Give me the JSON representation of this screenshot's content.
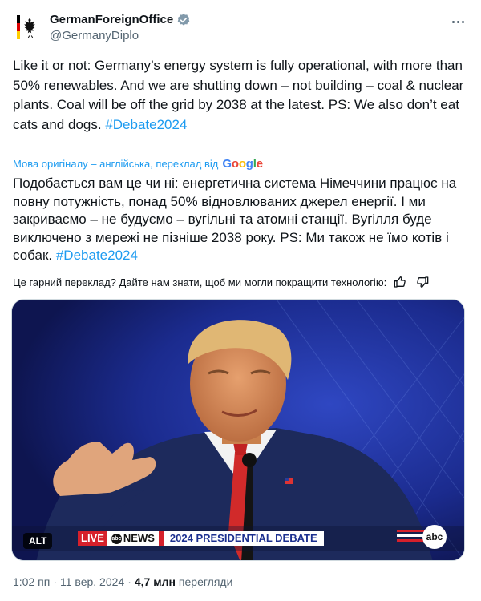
{
  "author": {
    "display_name": "GermanForeignOffice",
    "handle": "@GermanyDiplo",
    "verified_icon": "gov-verified-badge-icon",
    "avatar_icon": "federal-eagle-icon"
  },
  "tweet": {
    "text_before_hashtag": "Like it or not: Germany’s energy system is fully operational, with more than 50% renewables. And we are shutting down – not building – coal & nuclear plants. Coal will be off the grid by 2038 at the latest. PS: We also don’t eat cats and dogs. ",
    "hashtag": "#Debate2024"
  },
  "translation": {
    "note": "Мова оригіналу – англійська, переклад від",
    "provider": "Google",
    "text_before_hashtag": "Подобається вам це чи ні: енергетична система Німеччини працює на повну потужність, понад 50% відновлюваних джерел енергії. І ми закриваємо – не будуємо – вугільні та атомні станції. Вугілля буде виключено з мережі не пізніше 2038 року. PS: Ми також не їмо котів і собак. ",
    "hashtag": "#Debate2024",
    "feedback_prompt": "Це гарний переклад? Дайте нам знати, щоб ми могли покращити технологію:"
  },
  "media": {
    "alt_badge": "ALT",
    "live_label": "LIVE",
    "network_label": "NEWS",
    "network_circle": "abc",
    "banner_label": "2024 PRESIDENTIAL DEBATE",
    "corner_logo": "abc"
  },
  "meta": {
    "time": "1:02 пп",
    "date": "11 вер. 2024",
    "separator": "·",
    "views_count": "4,7 млн",
    "views_label": "перегляди"
  },
  "colors": {
    "accent": "#1d9bf0",
    "text": "#0f1419",
    "secondary": "#536471",
    "verified_gray": "#829aab"
  }
}
